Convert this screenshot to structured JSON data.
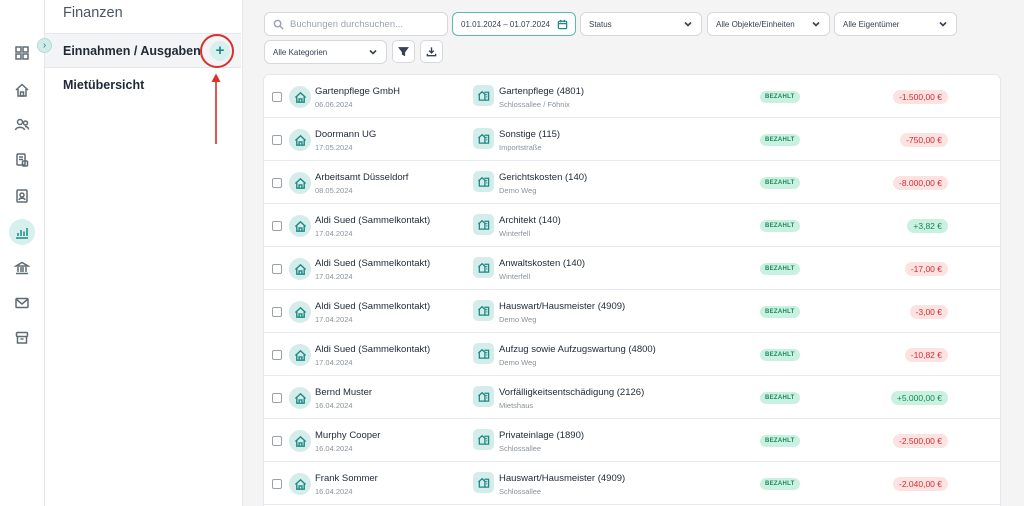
{
  "rail": {
    "items": [
      {
        "icon": "dashboard-icon"
      },
      {
        "icon": "home-icon"
      },
      {
        "icon": "people-icon"
      },
      {
        "icon": "documents-icon"
      },
      {
        "icon": "contact-card-icon"
      },
      {
        "icon": "finance-chart-icon",
        "active": true
      },
      {
        "icon": "bank-icon"
      },
      {
        "icon": "mail-icon"
      },
      {
        "icon": "archive-icon"
      }
    ]
  },
  "subnav": {
    "title": "Finanzen",
    "items": [
      {
        "label": "Einnahmen / Ausgaben",
        "active": true
      },
      {
        "label": "Mietübersicht"
      }
    ],
    "add_label": "+",
    "collapse_label": "›"
  },
  "filters": {
    "search_placeholder": "Buchungen durchsuchen...",
    "date_range": "01.01.2024 – 01.07.2024",
    "status": "Status",
    "objects": "Alle Objekte/Einheiten",
    "owners": "Alle Eigentümer",
    "categories": "Alle Kategorien"
  },
  "table": {
    "rows": [
      {
        "partner": "Gartenpflege GmbH",
        "date": "06.06.2024",
        "category": "Gartenpflege (4801)",
        "object": "Schlossallee / Föhnix",
        "status": "BEZAHLT",
        "amount": "-1.500,00 €",
        "sign": "neg"
      },
      {
        "partner": "Doormann UG",
        "date": "17.05.2024",
        "category": "Sonstige (115)",
        "object": "Importstraße",
        "status": "BEZAHLT",
        "amount": "-750,00 €",
        "sign": "neg"
      },
      {
        "partner": "Arbeitsamt Düsseldorf",
        "date": "08.05.2024",
        "category": "Gerichtskosten (140)",
        "object": "Demo Weg",
        "status": "BEZAHLT",
        "amount": "-8.000,00 €",
        "sign": "neg"
      },
      {
        "partner": "Aldi Sued (Sammelkontakt)",
        "date": "17.04.2024",
        "category": "Architekt (140)",
        "object": "Winterfell",
        "status": "BEZAHLT",
        "amount": "+3,82 €",
        "sign": "pos"
      },
      {
        "partner": "Aldi Sued (Sammelkontakt)",
        "date": "17.04.2024",
        "category": "Anwaltskosten (140)",
        "object": "Winterfell",
        "status": "BEZAHLT",
        "amount": "-17,00 €",
        "sign": "neg"
      },
      {
        "partner": "Aldi Sued (Sammelkontakt)",
        "date": "17.04.2024",
        "category": "Hauswart/Hausmeister (4909)",
        "object": "Demo Weg",
        "status": "BEZAHLT",
        "amount": "-3,00 €",
        "sign": "neg"
      },
      {
        "partner": "Aldi Sued (Sammelkontakt)",
        "date": "17.04.2024",
        "category": "Aufzug sowie Aufzugswartung (4800)",
        "object": "Demo Weg",
        "status": "BEZAHLT",
        "amount": "-10,82 €",
        "sign": "neg"
      },
      {
        "partner": "Bernd Muster",
        "date": "16.04.2024",
        "category": "Vorfälligkeitsentschädigung (2126)",
        "object": "Mietshaus",
        "status": "BEZAHLT",
        "amount": "+5.000,00 €",
        "sign": "pos"
      },
      {
        "partner": "Murphy Cooper",
        "date": "16.04.2024",
        "category": "Privateinlage (1890)",
        "object": "Schlossallee",
        "status": "BEZAHLT",
        "amount": "-2.500,00 €",
        "sign": "neg"
      },
      {
        "partner": "Frank Sommer",
        "date": "16.04.2024",
        "category": "Hauswart/Hausmeister (4909)",
        "object": "Schlossallee",
        "status": "BEZAHLT",
        "amount": "-2.040,00 €",
        "sign": "neg"
      }
    ]
  },
  "colors": {
    "accent": "#1c8a83",
    "accent_light": "#d4ecea",
    "negative": "#d62d2d",
    "positive": "#158a55",
    "annotation": "#d9302c"
  }
}
